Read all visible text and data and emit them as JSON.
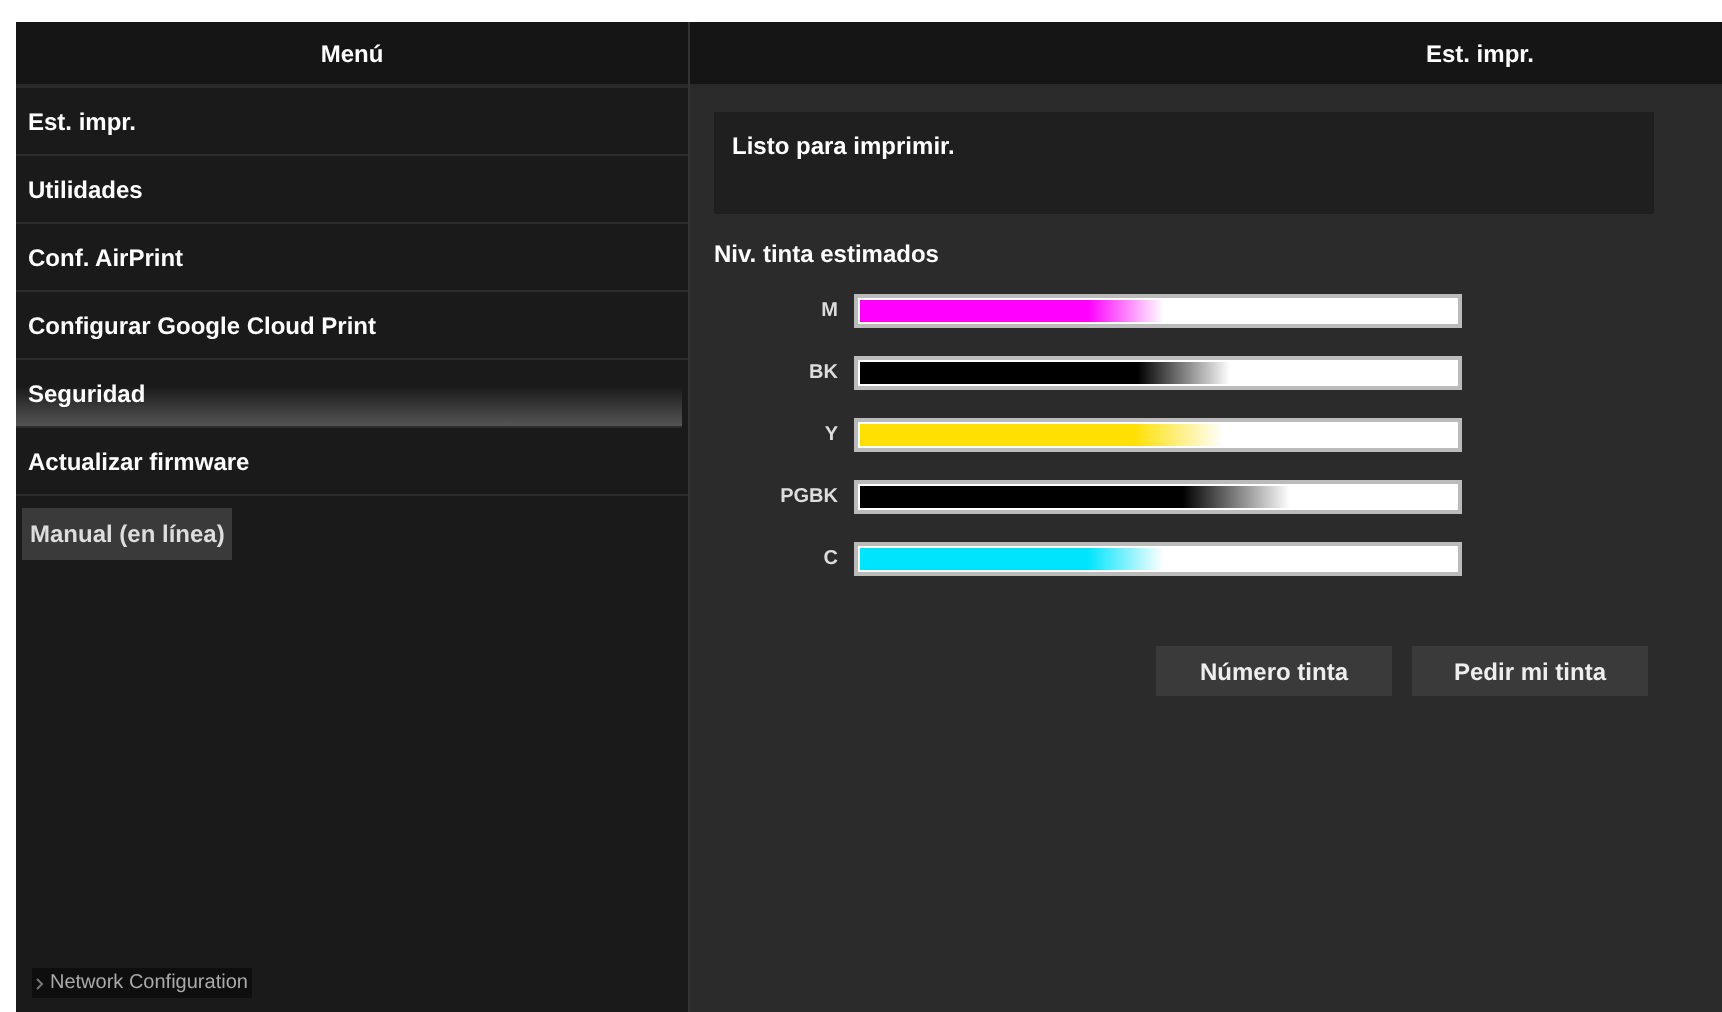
{
  "menu": {
    "title": "Menú",
    "items": [
      {
        "label": "Est. impr.",
        "selected": false
      },
      {
        "label": "Utilidades",
        "selected": false
      },
      {
        "label": "Conf. AirPrint",
        "selected": false
      },
      {
        "label": "Configurar Google Cloud Print",
        "selected": false
      },
      {
        "label": "Seguridad",
        "selected": true
      },
      {
        "label": "Actualizar firmware",
        "selected": false
      }
    ],
    "manual_button": "Manual (en línea)",
    "footer_link": "Network Configuration"
  },
  "main": {
    "title": "Est. impr.",
    "status": "Listo para imprimir.",
    "ink_heading": "Niv. tinta estimados",
    "inks": [
      {
        "name": "M",
        "color": "#ff00ff",
        "level": 0.51
      },
      {
        "name": "BK",
        "color": "#000000",
        "level": 0.62
      },
      {
        "name": "Y",
        "color": "#ffe000",
        "level": 0.61
      },
      {
        "name": "PGBK",
        "color": "#000000",
        "level": 0.72
      },
      {
        "name": "C",
        "color": "#00e5ff",
        "level": 0.51
      }
    ],
    "buttons": [
      "Número tinta",
      "Pedir mi tinta"
    ]
  }
}
